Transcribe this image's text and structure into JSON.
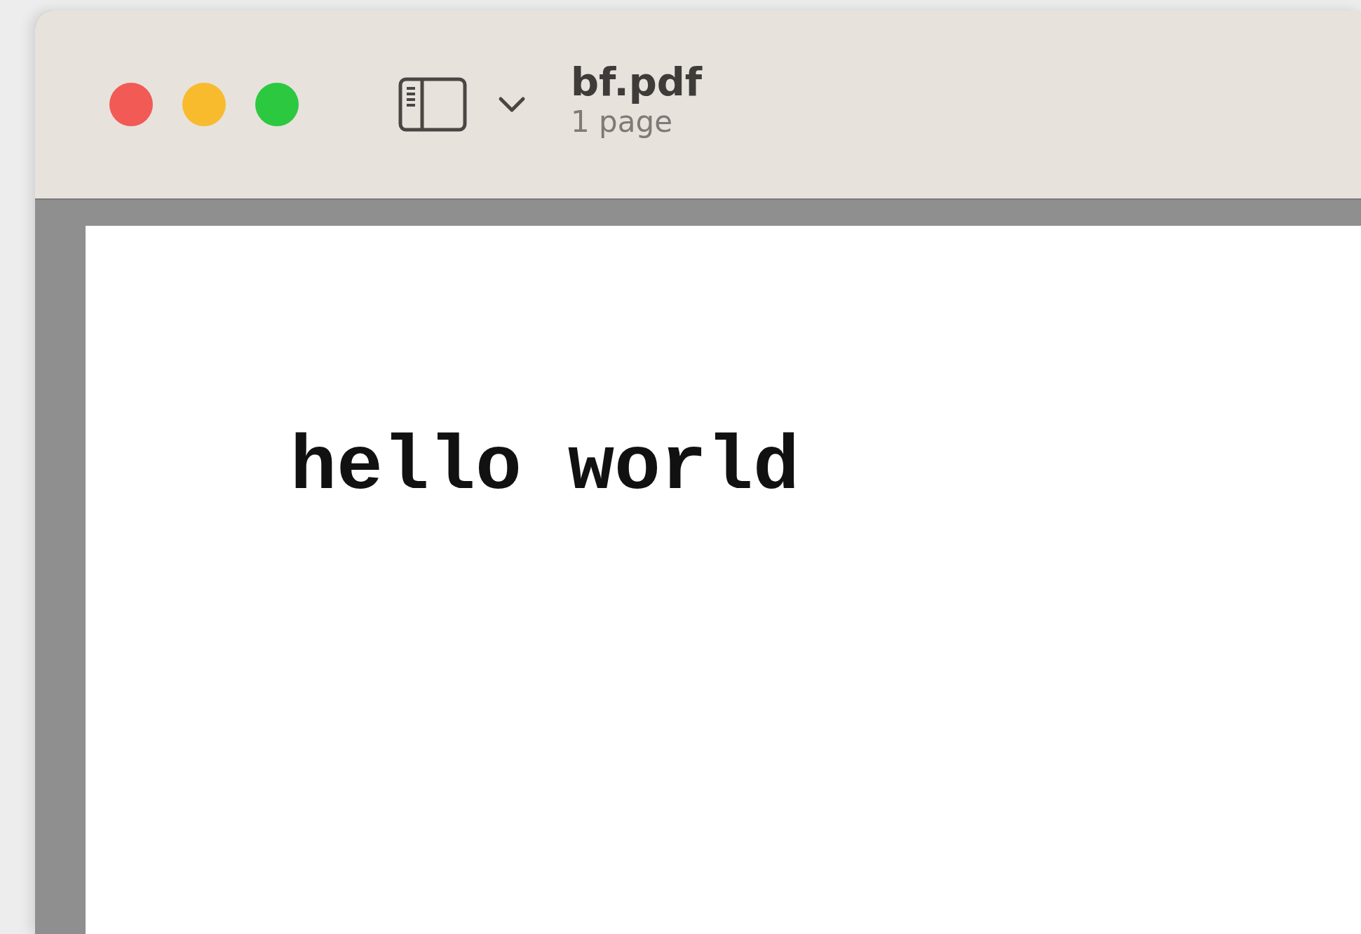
{
  "window": {
    "title": "bf.pdf",
    "subtitle": "1 page"
  },
  "document": {
    "text": "hello world"
  }
}
